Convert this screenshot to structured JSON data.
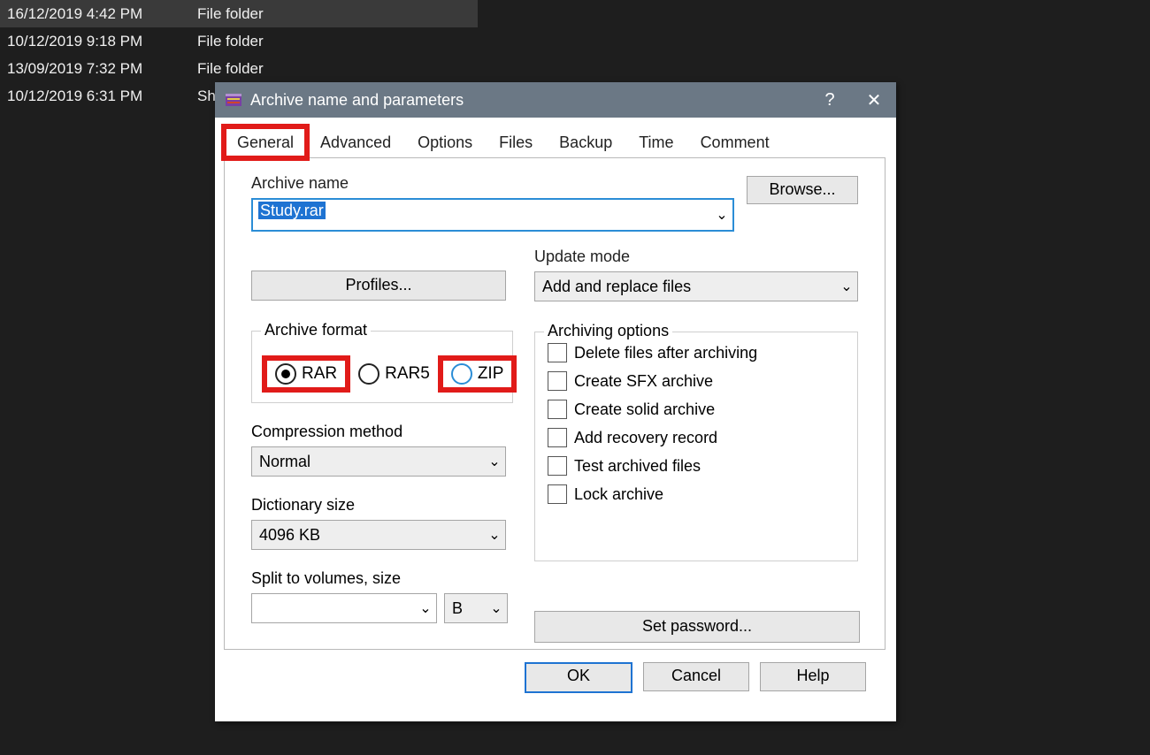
{
  "background_rows": [
    {
      "date": "16/12/2019 4:42 PM",
      "type": "File folder",
      "selected": true
    },
    {
      "date": "10/12/2019 9:18 PM",
      "type": "File folder",
      "selected": false
    },
    {
      "date": "13/09/2019 7:32 PM",
      "type": "File folder",
      "selected": false
    },
    {
      "date": "10/12/2019 6:31 PM",
      "type": "Sho",
      "selected": false
    }
  ],
  "dialog": {
    "title": "Archive name and parameters",
    "help_glyph": "?",
    "close_glyph": "✕",
    "tabs": [
      "General",
      "Advanced",
      "Options",
      "Files",
      "Backup",
      "Time",
      "Comment"
    ],
    "active_tab_index": 0,
    "highlighted_tabs": [
      0
    ],
    "archive_name_label": "Archive name",
    "archive_name_value": "Study.rar",
    "browse_label": "Browse...",
    "profiles_label": "Profiles...",
    "update_label": "Update mode",
    "update_value": "Add and replace files",
    "format_legend": "Archive format",
    "formats": [
      {
        "label": "RAR",
        "checked": true,
        "highlight": true
      },
      {
        "label": "RAR5",
        "checked": false,
        "highlight": false
      },
      {
        "label": "ZIP",
        "checked": false,
        "highlight": true
      }
    ],
    "compression_label": "Compression method",
    "compression_value": "Normal",
    "dict_label": "Dictionary size",
    "dict_value": "4096 KB",
    "split_label": "Split to volumes, size",
    "split_value": "",
    "split_unit": "B",
    "options_legend": "Archiving options",
    "options": [
      "Delete files after archiving",
      "Create SFX archive",
      "Create solid archive",
      "Add recovery record",
      "Test archived files",
      "Lock archive"
    ],
    "setpw_label": "Set password...",
    "ok_label": "OK",
    "cancel_label": "Cancel",
    "help_label": "Help"
  },
  "chevron_glyph": "⌄"
}
